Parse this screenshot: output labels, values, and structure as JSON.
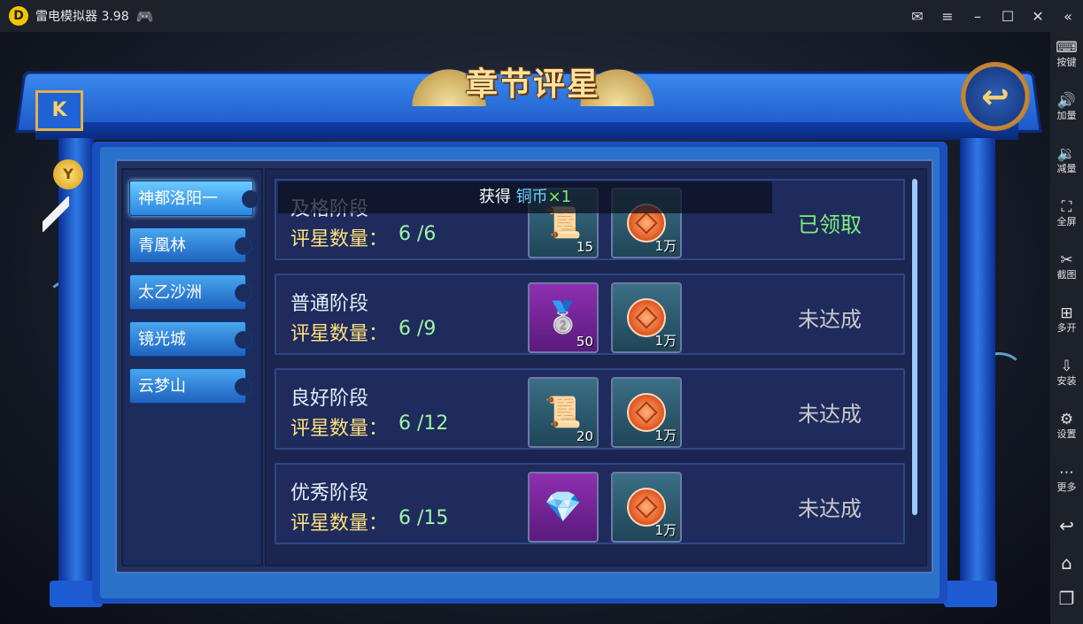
{
  "window": {
    "app_title": "雷电模拟器 3.98",
    "logo_glyph": "D",
    "gamepad_icon": "gamepad-icon",
    "controls": [
      "mail-icon",
      "menu-icon",
      "minimize-icon",
      "maximize-icon",
      "close-icon",
      "collapse-icon"
    ]
  },
  "sidebar": {
    "items": [
      {
        "icon": "keyboard-icon",
        "glyph": "⌨",
        "label": "按键"
      },
      {
        "icon": "volume-up-icon",
        "glyph": "🔊",
        "label": "加量"
      },
      {
        "icon": "volume-down-icon",
        "glyph": "🔉",
        "label": "减量"
      },
      {
        "icon": "fullscreen-icon",
        "glyph": "⛶",
        "label": "全屏"
      },
      {
        "icon": "scissors-icon",
        "glyph": "✂",
        "label": "截图"
      },
      {
        "icon": "multi-open-icon",
        "glyph": "⊞",
        "label": "多开"
      },
      {
        "icon": "apk-install-icon",
        "glyph": "⇩",
        "label": "安装"
      },
      {
        "icon": "settings-icon",
        "glyph": "⚙",
        "label": "设置"
      },
      {
        "icon": "more-icon",
        "glyph": "⋯",
        "label": "更多"
      }
    ],
    "nav": [
      {
        "icon": "back-icon",
        "glyph": "↩"
      },
      {
        "icon": "home-icon",
        "glyph": "⌂"
      },
      {
        "icon": "recent-apps-icon",
        "glyph": "❐"
      }
    ]
  },
  "game": {
    "banner_title": "章节评星",
    "back_glyph": "↩",
    "emblem_glyph": "K",
    "bell_glyph": "Y",
    "chapters": [
      {
        "label": "神都洛阳一",
        "active": true
      },
      {
        "label": "青凰林",
        "active": false
      },
      {
        "label": "太乙沙洲",
        "active": false
      },
      {
        "label": "镜光城",
        "active": false
      },
      {
        "label": "云梦山",
        "active": false
      }
    ],
    "star_label": "评星数量：",
    "rows": [
      {
        "stage": "及格阶段",
        "stars": "6 /6",
        "status": "已领取",
        "status_color": "#7ff07a",
        "rewards": [
          {
            "type": "scroll",
            "bg": "teal",
            "qty": "15"
          },
          {
            "type": "coin",
            "bg": "teal",
            "qty": "1万"
          }
        ]
      },
      {
        "stage": "普通阶段",
        "stars": "6 /9",
        "status": "未达成",
        "status_color": "#c9c9c9",
        "rewards": [
          {
            "type": "silver-ingot",
            "bg": "purple",
            "qty": "50"
          },
          {
            "type": "coin",
            "bg": "teal",
            "qty": "1万"
          }
        ]
      },
      {
        "stage": "良好阶段",
        "stars": "6 /12",
        "status": "未达成",
        "status_color": "#c9c9c9",
        "rewards": [
          {
            "type": "scroll",
            "bg": "teal",
            "qty": "20"
          },
          {
            "type": "coin",
            "bg": "teal",
            "qty": "1万"
          }
        ]
      },
      {
        "stage": "优秀阶段",
        "stars": "6 /15",
        "status": "未达成",
        "status_color": "#c9c9c9",
        "rewards": [
          {
            "type": "crystal",
            "bg": "purple",
            "qty": ""
          },
          {
            "type": "coin",
            "bg": "teal",
            "qty": "1万"
          }
        ]
      }
    ],
    "toast": {
      "prefix": "获得",
      "item": "铜币",
      "count": "×1"
    }
  }
}
